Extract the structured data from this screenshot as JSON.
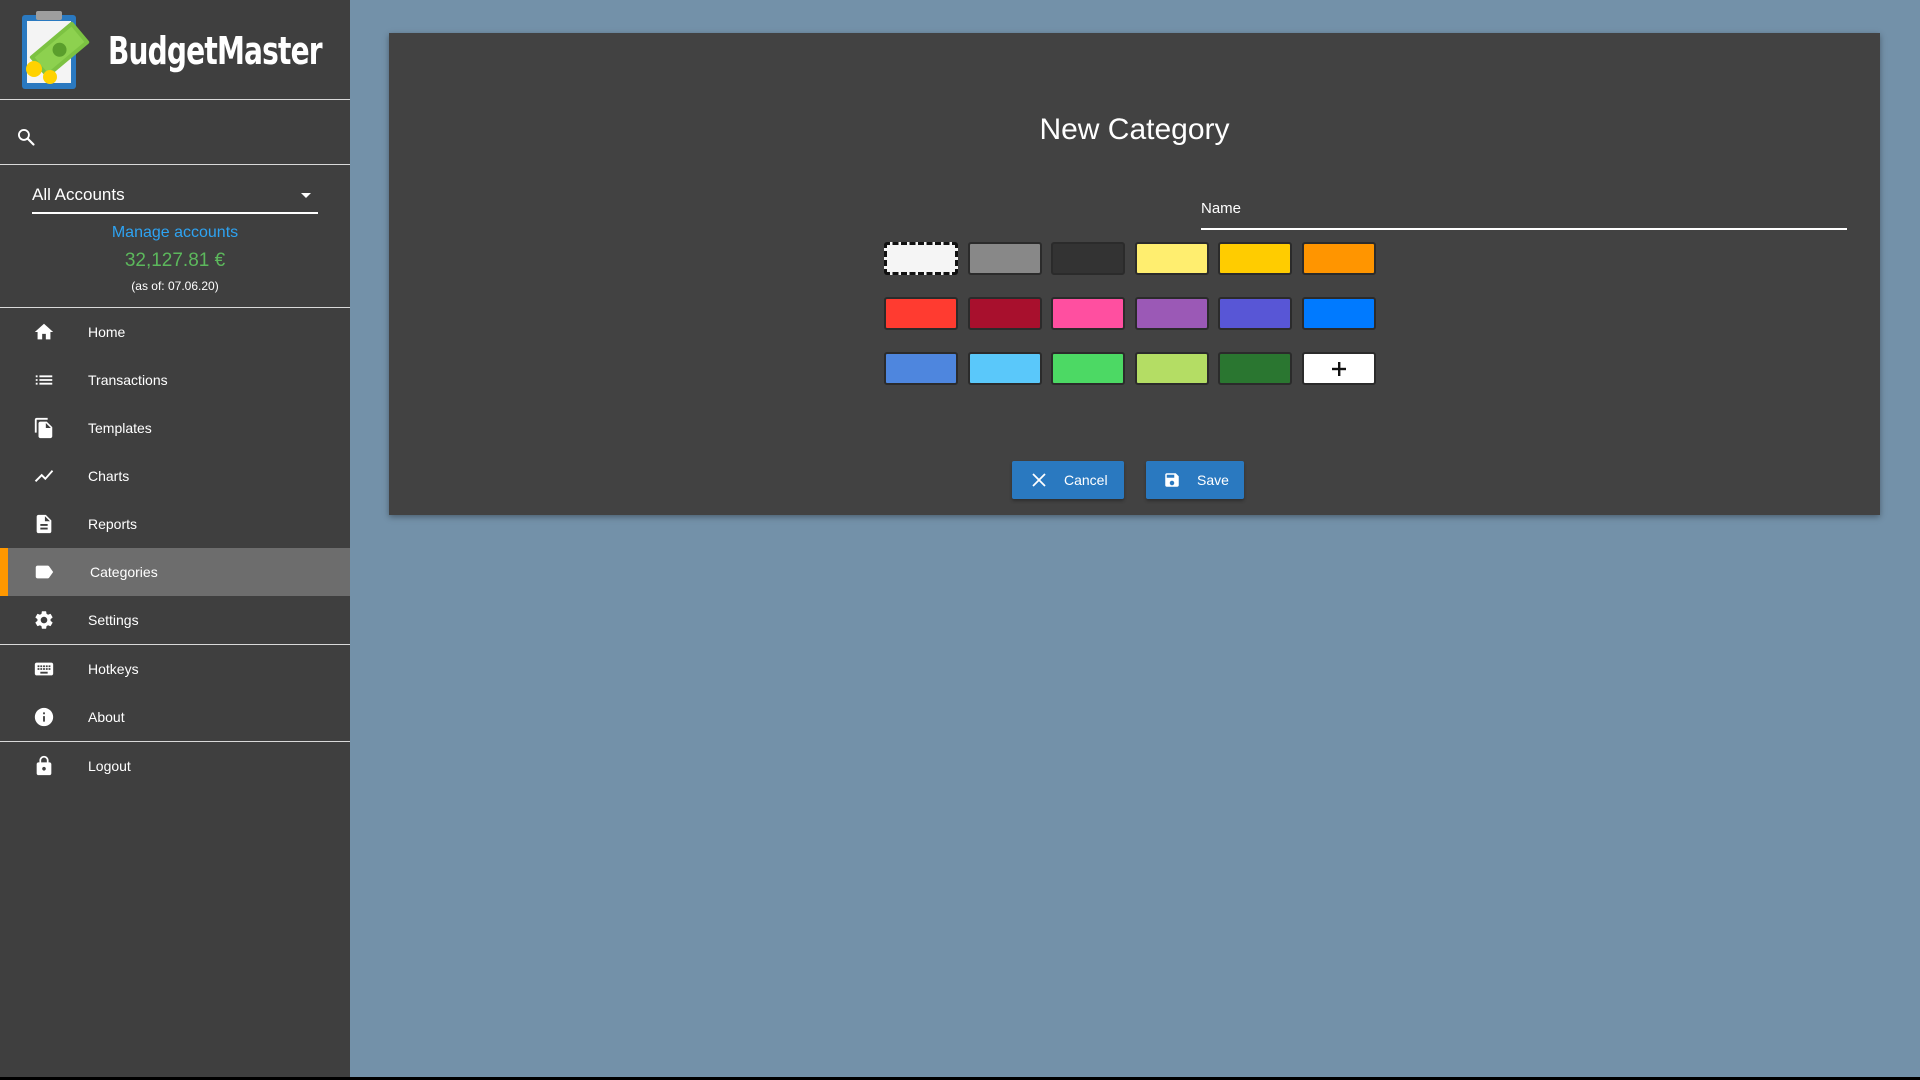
{
  "app": {
    "name": "BudgetMaster"
  },
  "sidebar": {
    "search": {
      "placeholder": "",
      "value": ""
    },
    "account_select": {
      "selected": "All Accounts"
    },
    "manage_accounts": "Manage accounts",
    "balance": "32,127.81 €",
    "as_of": "(as of: 07.06.20)",
    "items": [
      {
        "label": "Home",
        "icon": "home-icon",
        "active": false
      },
      {
        "label": "Transactions",
        "icon": "list-icon",
        "active": false
      },
      {
        "label": "Templates",
        "icon": "file-copy-icon",
        "active": false
      },
      {
        "label": "Charts",
        "icon": "chart-line-icon",
        "active": false
      },
      {
        "label": "Reports",
        "icon": "description-icon",
        "active": false
      },
      {
        "label": "Categories",
        "icon": "label-icon",
        "active": true
      },
      {
        "label": "Settings",
        "icon": "gear-icon",
        "active": false
      },
      {
        "label": "Hotkeys",
        "icon": "keyboard-icon",
        "active": false
      },
      {
        "label": "About",
        "icon": "info-icon",
        "active": false
      },
      {
        "label": "Logout",
        "icon": "lock-icon",
        "active": false
      }
    ]
  },
  "dialog": {
    "title": "New Category",
    "name_field": {
      "label": "Name",
      "value": ""
    },
    "colors": [
      [
        "#f5f5f5",
        "#888888",
        "#333333",
        "#ffee6f",
        "#ffcc00",
        "#ff9500"
      ],
      [
        "#ff3b30",
        "#a8102d",
        "#ff4fa0",
        "#9b59b6",
        "#5856d6",
        "#007aff"
      ],
      [
        "#4e86de",
        "#5ac8fa",
        "#4cd964",
        "#b4dd64",
        "#2a7630",
        "#ffffff"
      ]
    ],
    "selected_color": "#f5f5f5",
    "add_color_symbol": "+",
    "cancel_label": "Cancel",
    "save_label": "Save"
  },
  "colors": {
    "sidebar_bg": "#3f3f3f",
    "main_bg": "#7391a9",
    "card_bg": "#424242",
    "accent": "#ff9800",
    "button": "#2a79c0",
    "link": "#2ea3f2",
    "balance": "#5cb85c"
  }
}
